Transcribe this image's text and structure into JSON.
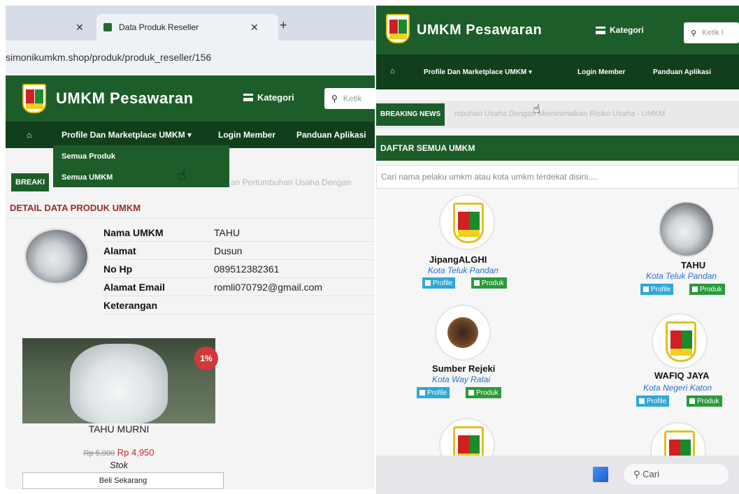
{
  "left_photo": {
    "browser": {
      "tabs": [
        {
          "title": "",
          "active": false
        },
        {
          "title": "Data Produk Reseller",
          "active": true
        }
      ],
      "new_tab_label": "+",
      "url": "simonikumkm.shop/produk/produk_reseller/156"
    },
    "header": {
      "brand": "UMKM Pesawaran",
      "kategori_label": "Kategori",
      "search_placeholder": "Ketik"
    },
    "nav": {
      "items": [
        "Profile Dan Marketplace UMKM ▾",
        "Login Member",
        "Panduan Aplikasi"
      ],
      "dropdown": [
        "Semua Produk",
        "Semua UMKM"
      ]
    },
    "breaking": {
      "label": "BREAKI",
      "ticker": "an Pertumbuhan Usaha Dengan"
    },
    "detail": {
      "title": "DETAIL DATA PRODUK UMKM",
      "rows": [
        {
          "key": "Nama UMKM",
          "value": "TAHU"
        },
        {
          "key": "Alamat",
          "value": "Dusun"
        },
        {
          "key": "No Hp",
          "value": "089512382361"
        },
        {
          "key": "Alamat Email",
          "value": "romli070792@gmail.com"
        },
        {
          "key": "Keterangan",
          "value": ""
        }
      ]
    },
    "product": {
      "discount_badge": "1%",
      "name": "TAHU MURNI",
      "old_price": "Rp 5,000",
      "new_price": "Rp 4,950",
      "stok_label": "Stok",
      "buy_button": "Beli Sekarang"
    }
  },
  "right_photo": {
    "header": {
      "brand": "UMKM Pesawaran",
      "kategori_label": "Kategori",
      "search_placeholder": "Ketik I"
    },
    "nav": {
      "items": [
        "Profile Dan Marketplace UMKM ▾",
        "Login Member",
        "Panduan Aplikasi"
      ]
    },
    "breaking": {
      "label": "BREAKING NEWS",
      "ticker": "mbuhan Usaha Dengan Meminimalkan Risiko Usaha - UMKM"
    },
    "list_title": "DAFTAR SEMUA UMKM",
    "search_placeholder": "Cari nama pelaku umkm atau kota umkm terdekat disini....",
    "umkm_cards": [
      {
        "name": "JipangALGHI",
        "city": "Kota Teluk Pandan",
        "avatar": "pesawaran-logo"
      },
      {
        "name": "TAHU",
        "city": "Kota Teluk Pandan",
        "avatar": "tofu-photo"
      },
      {
        "name": "Sumber Rejeki",
        "city": "Kota Way Ratai",
        "avatar": "sumber-rejeki-logo"
      },
      {
        "name": "WAFIQ JAYA",
        "city": "Kota Negeri Katon",
        "avatar": "pesawaran-logo"
      }
    ],
    "card_buttons": {
      "profile": "Profile",
      "produk": "Produk"
    },
    "taskbar": {
      "search_label": "Cari"
    }
  }
}
